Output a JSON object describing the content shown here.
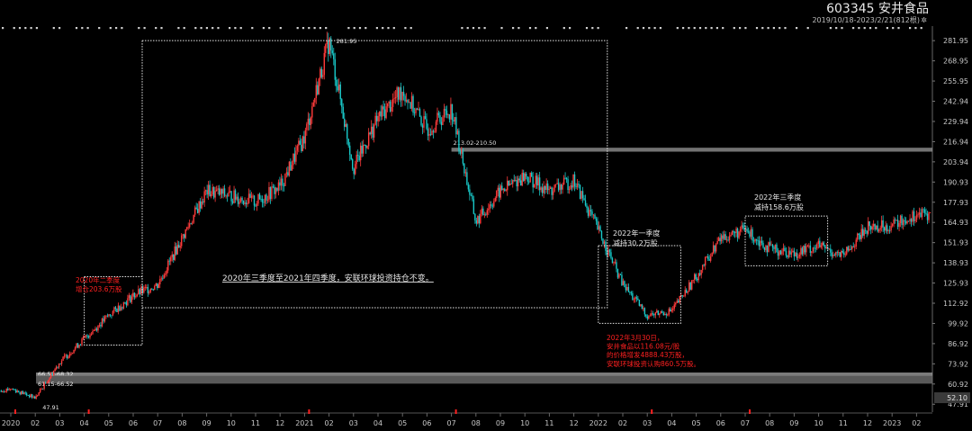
{
  "header": {
    "stock_code": "603345",
    "stock_name": "安井食品",
    "date_range": "2019/10/18-2023/2/21(812根)",
    "suffix": "✲"
  },
  "colors": {
    "background": "#000000",
    "up": "#ff3b3b",
    "down": "#19c9c9",
    "annotation_red": "#ff2020",
    "annotation_white": "#e6e6e6",
    "axis_text": "#c8c8c8",
    "band_gray": "#8a8a8a",
    "last_price_box": "#3a3a3a"
  },
  "chart_data": {
    "type": "candlestick",
    "y_axis": {
      "ylim": [
        44,
        289
      ],
      "tick_labels": [
        "281.95",
        "268.95",
        "255.95",
        "242.94",
        "229.94",
        "216.94",
        "203.94",
        "190.93",
        "177.93",
        "164.93",
        "151.93",
        "138.93",
        "125.93",
        "112.92",
        "99.92",
        "86.92",
        "73.92",
        "60.92",
        "47.91"
      ],
      "tick_values": [
        281.95,
        268.95,
        255.95,
        242.94,
        229.94,
        216.94,
        203.94,
        190.93,
        177.93,
        164.93,
        151.93,
        138.93,
        125.93,
        112.92,
        99.92,
        86.92,
        73.92,
        60.92,
        47.91
      ],
      "last_price_label": "52.10",
      "last_price_value": 52.1
    },
    "x_axis": {
      "labels": [
        "2020",
        "02",
        "03",
        "04",
        "05",
        "06",
        "07",
        "08",
        "09",
        "10",
        "11",
        "12",
        "2021",
        "02",
        "03",
        "04",
        "05",
        "06",
        "07",
        "08",
        "09",
        "10",
        "11",
        "12",
        "2022",
        "02",
        "03",
        "04",
        "05",
        "06",
        "07",
        "08",
        "09",
        "10",
        "11",
        "12",
        "2023",
        "02"
      ],
      "start_month": "2020-01",
      "end_month": "2023-02"
    },
    "price_path": [
      [
        "2019-12",
        55
      ],
      [
        "2020-01",
        58
      ],
      [
        "2020-02",
        52
      ],
      [
        "2020-03",
        75
      ],
      [
        "2020-04",
        90
      ],
      [
        "2020-05",
        105
      ],
      [
        "2020-06",
        118
      ],
      [
        "2020-07",
        125
      ],
      [
        "2020-08",
        155
      ],
      [
        "2020-09",
        185
      ],
      [
        "2020-10",
        182
      ],
      [
        "2020-11",
        178
      ],
      [
        "2020-12",
        188
      ],
      [
        "2021-01",
        220
      ],
      [
        "2021-02",
        281.95
      ],
      [
        "2021-03",
        200
      ],
      [
        "2021-04",
        232
      ],
      [
        "2021-05",
        250
      ],
      [
        "2021-06",
        225
      ],
      [
        "2021-07",
        238
      ],
      [
        "2021-08",
        165
      ],
      [
        "2021-09",
        185
      ],
      [
        "2021-10",
        195
      ],
      [
        "2021-11",
        185
      ],
      [
        "2021-12",
        192
      ],
      [
        "2022-01",
        160
      ],
      [
        "2022-02",
        125
      ],
      [
        "2022-03",
        105
      ],
      [
        "2022-04",
        108
      ],
      [
        "2022-05",
        130
      ],
      [
        "2022-06",
        155
      ],
      [
        "2022-07",
        160
      ],
      [
        "2022-08",
        148
      ],
      [
        "2022-09",
        145
      ],
      [
        "2022-10",
        150
      ],
      [
        "2022-11",
        143
      ],
      [
        "2022-12",
        162
      ],
      [
        "2023-01",
        163
      ],
      [
        "2023-02",
        170
      ]
    ],
    "price_labels": [
      {
        "text": "281.95",
        "value": 281.95,
        "month": "2021-02"
      },
      {
        "text": "47.91",
        "value": 47.91,
        "month": "2020-02"
      }
    ],
    "resistance_band": {
      "label": "213.02-210.50",
      "from": 210.5,
      "to": 213.02,
      "start_month": "2021-07",
      "end_month": "2023-02"
    },
    "support_bands": [
      {
        "label": "66.52-68.32",
        "from": 66.52,
        "to": 68.32,
        "start_month": "2020-01",
        "end_month": "2023-02"
      },
      {
        "label": "61.15-66.52",
        "from": 61.15,
        "to": 66.52,
        "start_month": "2020-01",
        "end_month": "2023-02"
      }
    ],
    "boxes": [
      {
        "name": "box-2020q2",
        "start_month": "2020-04",
        "end_month": "2020-06",
        "low": 86,
        "high": 130
      },
      {
        "name": "box-2020q3-2021q4",
        "start_month": "2020-06",
        "end_month": "2022-01",
        "low": 110,
        "high": 282
      },
      {
        "name": "box-2022q1",
        "start_month": "2022-01",
        "end_month": "2022-04",
        "low": 100,
        "high": 150
      },
      {
        "name": "box-2022q3",
        "start_month": "2022-07",
        "end_month": "2022-10",
        "low": 137,
        "high": 169
      }
    ],
    "annotations": [
      {
        "name": "annotation-2020q2",
        "color": "red",
        "lines": [
          "2020年二季度",
          "增仓203.6万股"
        ]
      },
      {
        "name": "annotation-hold",
        "color": "white",
        "underline": true,
        "lines": [
          "2020年三季度至2021年四季度，安联环球投资持仓不变。"
        ]
      },
      {
        "name": "annotation-2022q1",
        "color": "white",
        "lines": [
          "2022年一季度",
          "减持30.2万股"
        ]
      },
      {
        "name": "annotation-2022q3",
        "color": "white",
        "lines": [
          "2022年三季度",
          "减持158.6万股"
        ]
      },
      {
        "name": "annotation-2022-3-30",
        "color": "red",
        "lines": [
          "2022年3月30日，",
          "安井食品以116.08元/股",
          "的价格增发4888.43万股，",
          "安联环球投资认购860.5万股。"
        ]
      }
    ]
  }
}
